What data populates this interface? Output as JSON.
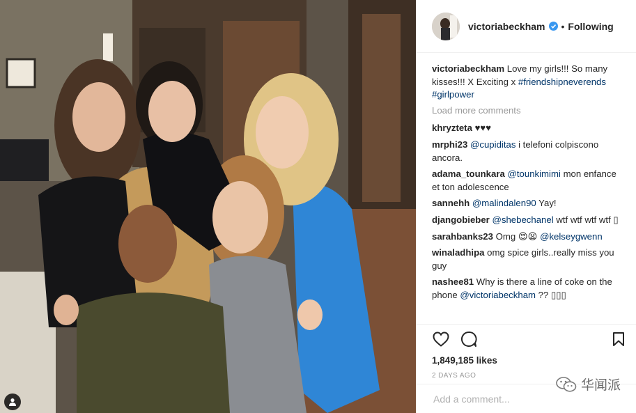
{
  "header": {
    "username": "victoriabeckham",
    "separator": "•",
    "follow_status": "Following"
  },
  "caption": {
    "username": "victoriabeckham",
    "text": "Love my girls!!! So many kisses!!! X Exciting x",
    "hashtags": [
      "#friendshipneverends",
      "#girlpower"
    ]
  },
  "load_more": "Load more comments",
  "comments": [
    {
      "user": "khryzteta",
      "text": "♥♥♥"
    },
    {
      "user": "mrphi23",
      "mention": "@cupiditas",
      "text": " i telefoni colpiscono ancora."
    },
    {
      "user": "adama_tounkara",
      "mention": "@tounkimimi",
      "text": " mon enfance et ton adolescence"
    },
    {
      "user": "sannehh",
      "mention": "@malindalen90",
      "text": " Yay!"
    },
    {
      "user": "djangobieber",
      "mention": "@shebechanel",
      "text": " wtf wtf wtf wtf ▯"
    },
    {
      "user": "sarahbanks23",
      "text": "Omg 😍😫 ",
      "mention_after": "@kelseygwenn"
    },
    {
      "user": "winaladhipa",
      "text": "omg spice girls..really miss you guy"
    },
    {
      "user": "nashee81",
      "text": "Why is there a line of coke on the phone ",
      "mention_after": "@victoriabeckham",
      "tail": " ?? ▯▯▯"
    }
  ],
  "likes": "1,849,185 likes",
  "date": "2 DAYS AGO",
  "add_comment": {
    "placeholder": "Add a comment..."
  },
  "watermark": {
    "text": "华闻派"
  },
  "icons": {
    "verified": "verified-badge-icon",
    "like": "heart-icon",
    "comment": "comment-bubble-icon",
    "save": "bookmark-icon",
    "tag": "person-tag-icon",
    "watermark": "wechat-logo-icon"
  },
  "colors": {
    "verified": "#3897f0",
    "link": "#003569",
    "muted": "#999999",
    "border": "#efefef"
  }
}
